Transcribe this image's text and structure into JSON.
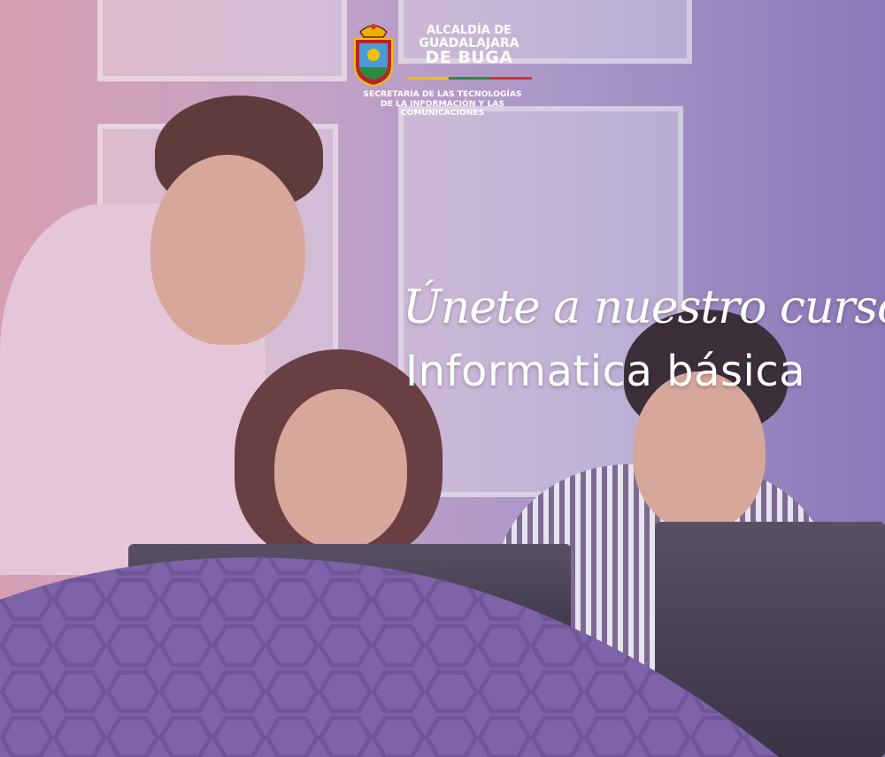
{
  "logo": {
    "title_line1": "ALCALDÍA DE",
    "title_line2": "GUADALAJARA",
    "title_line3": "DE BUGA",
    "subtitle_line1": "SECRETARÍA DE LAS TECNOLOGÍAS",
    "subtitle_line2": "DE LA INFORMACIÓN Y LAS",
    "subtitle_line3": "COMUNICACIONES"
  },
  "headline": {
    "script": "Únete a nuestro curso",
    "main": "Informatica básica"
  },
  "colors": {
    "overlay_pink": "#d79fb2",
    "overlay_purple": "#8a78b9",
    "wave_purple": "#7d63a8",
    "hex_line": "#6d5597",
    "text": "#ffffff",
    "flag_yellow": "#f2c200",
    "flag_green": "#2d8a3d",
    "flag_red": "#d6332c"
  },
  "icons": {
    "crest": "coat-of-arms-icon"
  }
}
